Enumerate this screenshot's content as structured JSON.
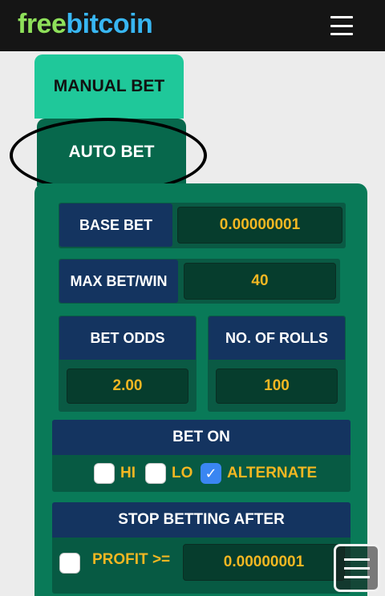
{
  "header": {
    "logo_part1": "free",
    "logo_part2": "bitcoin",
    "menu_icon": "hamburger-icon"
  },
  "tabs": {
    "manual": "MANUAL BET",
    "auto": "AUTO BET"
  },
  "auto_bet": {
    "base_bet_label": "BASE BET",
    "base_bet_value": "0.00000001",
    "max_bet_label": "MAX BET/WIN",
    "max_bet_value": "40",
    "bet_odds_label": "BET ODDS",
    "bet_odds_value": "2.00",
    "rolls_label": "NO. OF ROLLS",
    "rolls_value": "100",
    "bet_on": {
      "title": "BET ON",
      "options": [
        {
          "label": "HI",
          "checked": false
        },
        {
          "label": "LO",
          "checked": false
        },
        {
          "label": "ALTERNATE",
          "checked": true
        }
      ]
    },
    "stop_after": {
      "title": "STOP BETTING AFTER",
      "profit_label": "PROFIT >=",
      "profit_value": "0.00000001",
      "profit_checked": false
    }
  },
  "colors": {
    "accent_green": "#1fc89a",
    "panel_green": "#097a58",
    "label_navy": "#143460",
    "value_gold": "#f3b722"
  }
}
